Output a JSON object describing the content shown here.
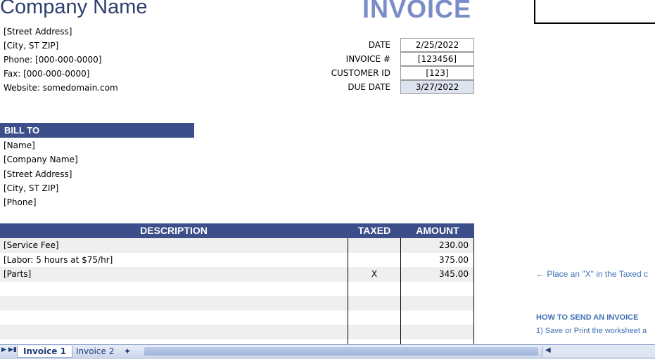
{
  "header": {
    "company_name": "Company Name",
    "title": "INVOICE"
  },
  "address": [
    "[Street Address]",
    "[City, ST  ZIP]",
    "Phone: [000-000-0000]",
    "Fax: [000-000-0000]",
    "Website: somedomain.com"
  ],
  "meta": [
    {
      "label": "DATE",
      "value": "2/25/2022"
    },
    {
      "label": "INVOICE #",
      "value": "[123456]"
    },
    {
      "label": "CUSTOMER ID",
      "value": "[123]"
    },
    {
      "label": "DUE DATE",
      "value": "3/27/2022"
    }
  ],
  "bill_to": {
    "heading": "BILL TO",
    "lines": [
      "[Name]",
      "[Company Name]",
      "[Street Address]",
      "[City, ST  ZIP]",
      "[Phone]"
    ]
  },
  "table": {
    "headers": {
      "description": "DESCRIPTION",
      "taxed": "TAXED",
      "amount": "AMOUNT"
    },
    "rows": [
      {
        "description": "[Service Fee]",
        "taxed": "",
        "amount": "230.00"
      },
      {
        "description": "[Labor: 5 hours at $75/hr]",
        "taxed": "",
        "amount": "375.00"
      },
      {
        "description": "[Parts]",
        "taxed": "X",
        "amount": "345.00"
      },
      {
        "description": "",
        "taxed": "",
        "amount": ""
      },
      {
        "description": "",
        "taxed": "",
        "amount": ""
      },
      {
        "description": "",
        "taxed": "",
        "amount": ""
      },
      {
        "description": "",
        "taxed": "",
        "amount": ""
      }
    ]
  },
  "side_notes": {
    "taxed_hint": "← Place an \"X\" in the Taxed c",
    "howto_heading": "HOW TO SEND AN INVOICE",
    "step1": "1) Save or Print the worksheet a"
  },
  "sheet_tabs": {
    "tab1": "Invoice 1",
    "tab2": "Invoice 2"
  },
  "colors": {
    "header_bg": "#3c4f8a",
    "title": "#7a8cc9",
    "company": "#2e3f6e",
    "due_bg": "#dde3ef",
    "note_text": "#3f6fb6"
  }
}
